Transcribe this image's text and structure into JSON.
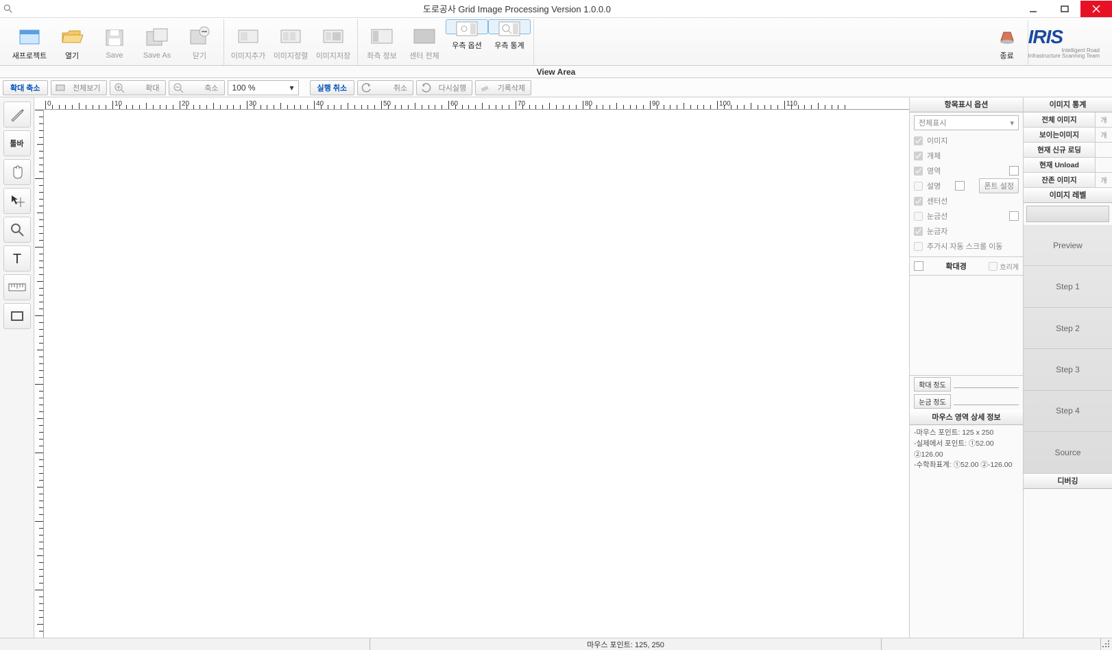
{
  "titlebar": {
    "title": "도로공사 Grid Image Processing Version 1.0.0.0"
  },
  "ribbon": {
    "new_project": "새프로젝트",
    "open": "열기",
    "save": "Save",
    "save_as": "Save As",
    "close": "닫기",
    "img_add": "이미지추가",
    "img_sort": "이미지정렬",
    "img_save": "이미지저장",
    "left_info": "좌측 정보",
    "center_all": "센터 전체",
    "right_opt": "우측 옵션",
    "right_stat": "우측 통계",
    "exit": "종료"
  },
  "viewarea_label": "View Area",
  "subbar": {
    "zoom_inout": "확대 축소",
    "view_all": "전체보기",
    "zoom_in": "확대",
    "zoom_out": "축소",
    "zoom_pct": "100 %",
    "exec_cancel": "실행 취소",
    "cancel": "취소",
    "redo": "다시실행",
    "del_record": "기록삭제"
  },
  "leftbar": {
    "toolbar_label": "툴바"
  },
  "ruler": {
    "marks": [
      "0",
      "10",
      "20",
      "30",
      "40",
      "50",
      "60",
      "70",
      "80",
      "90",
      "100",
      "110"
    ]
  },
  "rightpanel": {
    "display_opt_title": "항목표시 옵션",
    "view_mode": "전체표시",
    "chk_image": "이미지",
    "chk_object": "개체",
    "chk_area": "영역",
    "chk_desc": "설명",
    "font_setting": "폰트 설정",
    "chk_centerline": "센터선",
    "chk_gridline": "눈금선",
    "chk_ruler": "눈금자",
    "chk_autoscroll": "추가시 자동 스크롤 이동",
    "magnifier": "확대경",
    "blur": "흐리게",
    "zoom_level": "확대 정도",
    "grid_level": "눈금 정도",
    "mouse_title": "마우스 영역 상세 정보",
    "mouse_l1": "-마우스 포인트: 125 x 250",
    "mouse_l2": "-실제에서 포인트: ①52.00 ②126.00",
    "mouse_l3": "-수학좌표계: ①52.00 ②-126.00"
  },
  "stats": {
    "title": "이미지 통계",
    "total_img": "전체 이미지",
    "total_img_v": "개",
    "visible_img": "보이는이미지",
    "visible_img_v": "개",
    "new_loading": "현재 신규 로딩",
    "unload": "현재 Unload",
    "remaining": "잔존 이미지",
    "remaining_v": "개",
    "label_title": "이미지 레벨",
    "preview": "Preview",
    "step1": "Step 1",
    "step2": "Step 2",
    "step3": "Step 3",
    "step4": "Step 4",
    "source": "Source",
    "debug": "디버깅"
  },
  "statusbar": {
    "mouse": "마우스 포인트: 125, 250"
  }
}
